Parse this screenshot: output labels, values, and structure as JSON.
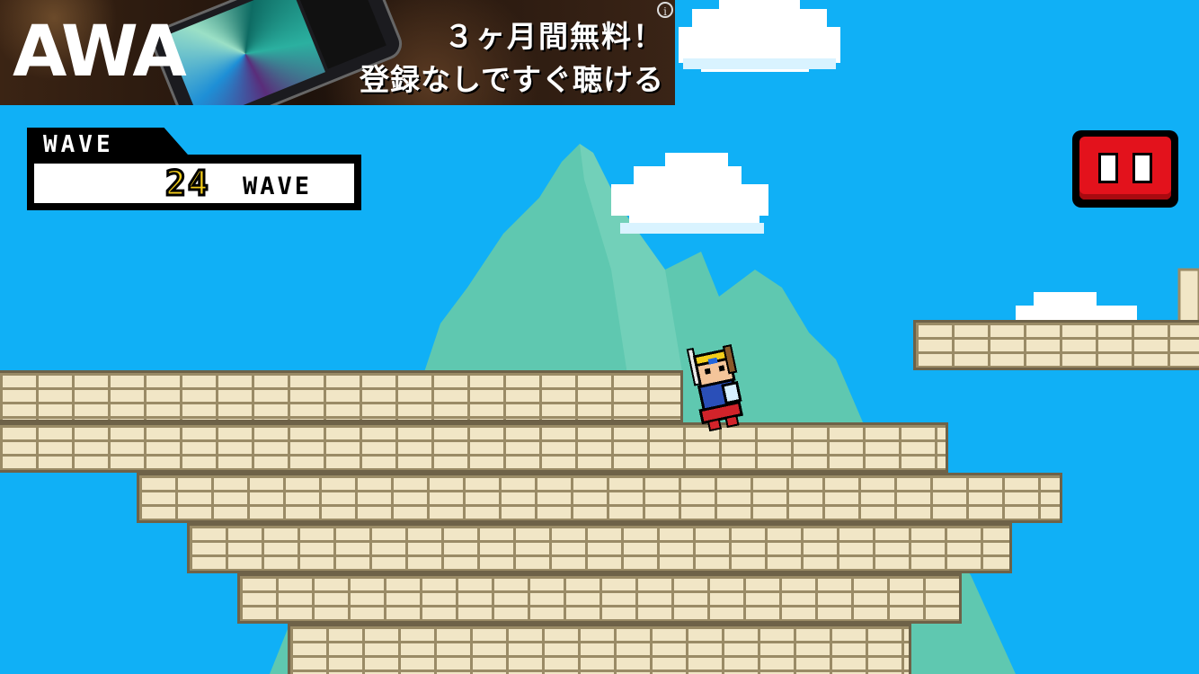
{
  "ad": {
    "brand": "AWA",
    "headline": "３ヶ月間無料！",
    "subline": "登録なしですぐ聴ける",
    "info": "i"
  },
  "hud": {
    "wave_tab_label": "WAVE",
    "wave_number": "24",
    "wave_unit": "WAVE"
  },
  "colors": {
    "sky": "#10b0f6",
    "mountain": "#5fc8b0",
    "brick": "#f1e6c6",
    "pause_red": "#e3121c",
    "wave_number": "#f3cd1a"
  },
  "icons": {
    "pause": "pause-icon",
    "character": "hero-knight-sprite"
  }
}
